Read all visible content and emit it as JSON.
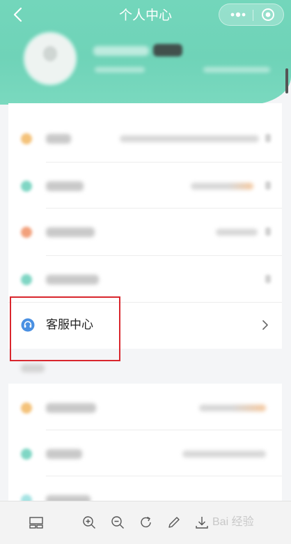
{
  "header": {
    "title": "个人中心",
    "back_icon": "chevron-left-icon",
    "more_icon": "more-dots-icon",
    "target_icon": "target-circle-icon",
    "background": "#73d6bb"
  },
  "menu": {
    "customer_service_label": "客服中心",
    "customer_service_icon": "headset-icon",
    "icon_color": "#4a90e2",
    "blurred_row_colors": [
      "#f4c27a",
      "#7fd6c4",
      "#f2a07b",
      "#7fd6c4"
    ],
    "lower_blurred_row_colors": [
      "#f4c27a",
      "#7fd6c4",
      "#a5e3e3"
    ]
  },
  "annotation": {
    "highlight_color": "#d9262d"
  },
  "toolbar": {
    "icons": [
      "layout-icon",
      "zoom-in-icon",
      "zoom-out-icon",
      "rotate-icon",
      "edit-pen-icon",
      "download-icon"
    ],
    "watermark": "Bai 经验"
  }
}
